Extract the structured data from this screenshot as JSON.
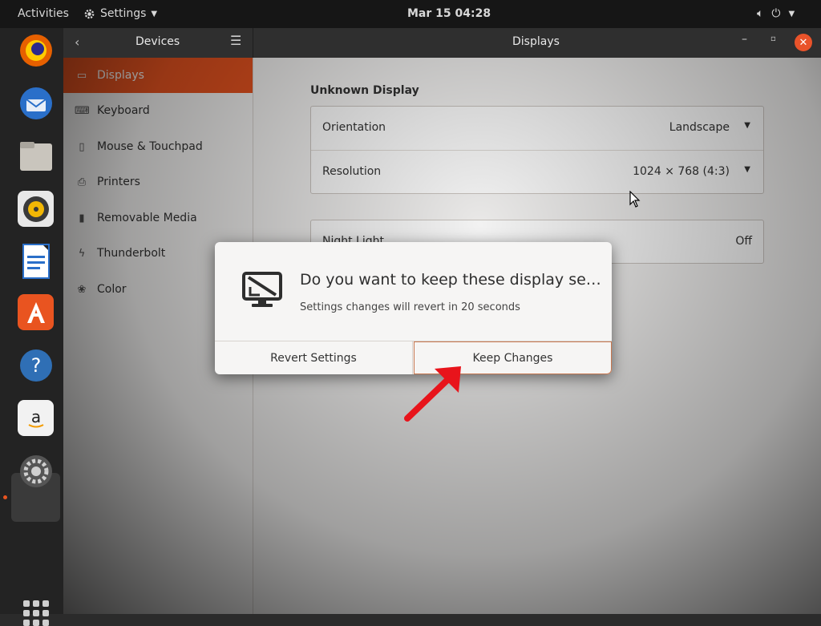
{
  "topbar": {
    "activities": "Activities",
    "app_name": "Settings",
    "clock": "Mar 15  04:28"
  },
  "dock": {
    "icons": [
      "firefox-icon",
      "thunderbird-icon",
      "files-icon",
      "rhythmbox-icon",
      "writer-icon",
      "software-icon",
      "help-icon",
      "amazon-icon",
      "settings-icon",
      "app-grid-icon"
    ]
  },
  "window": {
    "left_title": "Devices",
    "right_title": "Displays"
  },
  "sidebar": {
    "items": [
      {
        "label": "Displays",
        "icon": "display-icon",
        "active": true
      },
      {
        "label": "Keyboard",
        "icon": "keyboard-icon",
        "active": false
      },
      {
        "label": "Mouse & Touchpad",
        "icon": "mouse-icon",
        "active": false
      },
      {
        "label": "Printers",
        "icon": "printer-icon",
        "active": false
      },
      {
        "label": "Removable Media",
        "icon": "removable-media-icon",
        "active": false
      },
      {
        "label": "Thunderbolt",
        "icon": "thunderbolt-icon",
        "active": false
      },
      {
        "label": "Color",
        "icon": "color-icon",
        "active": false
      }
    ]
  },
  "main": {
    "display_name": "Unknown Display",
    "orientation": {
      "label": "Orientation",
      "value": "Landscape"
    },
    "resolution": {
      "label": "Resolution",
      "value": "1024 × 768 (4:3)"
    },
    "night_light": {
      "label": "Night Light",
      "value": "Off"
    }
  },
  "dialog": {
    "title": "Do you want to keep these display se…",
    "subtitle": "Settings changes will revert in 20 seconds",
    "revert_label": "Revert Settings",
    "keep_label": "Keep Changes"
  },
  "colors": {
    "accent": "#e95420",
    "annotation_arrow": "#e8141b"
  }
}
